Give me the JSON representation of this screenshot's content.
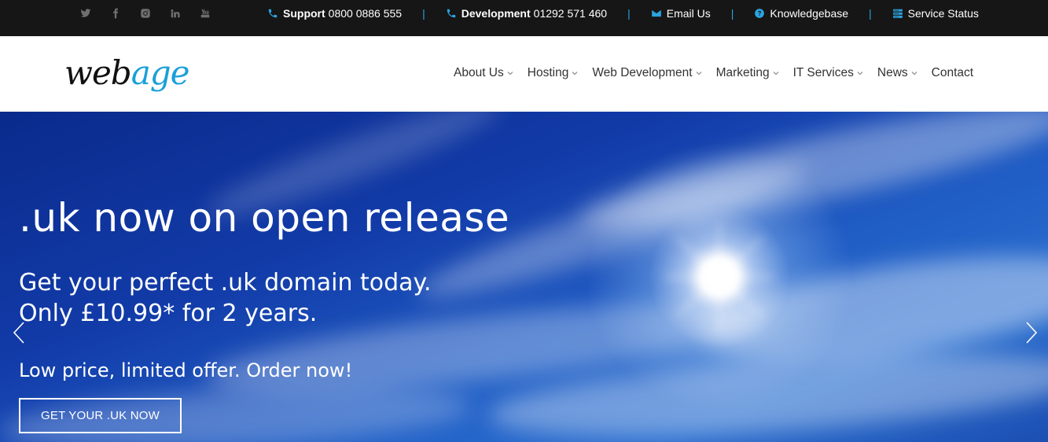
{
  "topbar": {
    "socials": [
      {
        "icon": "twitter-icon"
      },
      {
        "icon": "facebook-icon"
      },
      {
        "icon": "instagram-icon"
      },
      {
        "icon": "linkedin-icon"
      },
      {
        "icon": "youtube-icon"
      }
    ],
    "support_label": "Support",
    "support_phone": "0800 0886 555",
    "development_label": "Development",
    "development_phone": "01292 571 460",
    "email_label": "Email Us",
    "knowledgebase_label": "Knowledgebase",
    "service_status_label": "Service Status",
    "separator": "|",
    "accent_color": "#2ba4e0"
  },
  "header": {
    "logo_part1": "web",
    "logo_part2": "age",
    "nav": [
      {
        "label": "About Us",
        "dropdown": true
      },
      {
        "label": "Hosting",
        "dropdown": true
      },
      {
        "label": "Web Development",
        "dropdown": true
      },
      {
        "label": "Marketing",
        "dropdown": true
      },
      {
        "label": "IT Services",
        "dropdown": true
      },
      {
        "label": "News",
        "dropdown": true
      },
      {
        "label": "Contact",
        "dropdown": false
      }
    ]
  },
  "hero": {
    "title": ".uk now on open release",
    "line1": "Get your perfect .uk domain today.",
    "line2": "Only £10.99* for 2 years.",
    "line3": "Low price, limited offer. Order now!",
    "cta_label": "GET YOUR .UK NOW"
  }
}
